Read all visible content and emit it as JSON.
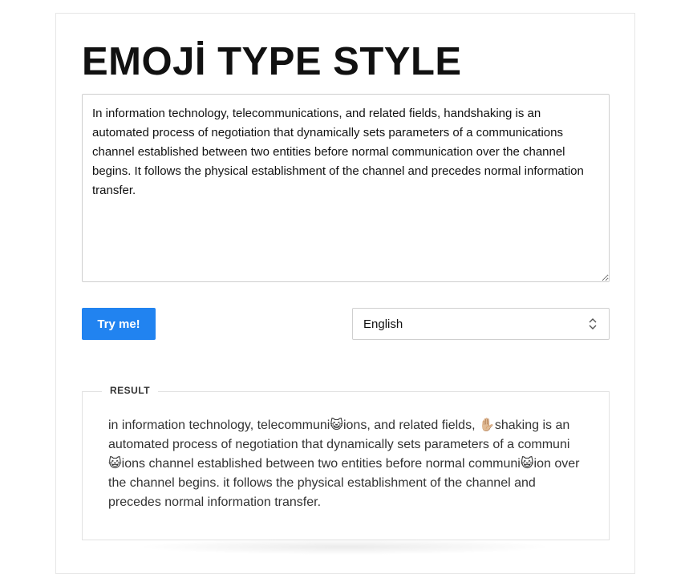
{
  "header": {
    "title": "EMOJİ TYPE STYLE"
  },
  "input": {
    "value": "In information technology, telecommunications, and related fields, handshaking is an automated process of negotiation that dynamically sets parameters of a communications channel established between two entities before normal communication over the channel begins. It follows the physical establishment of the channel and precedes normal information transfer."
  },
  "controls": {
    "try_label": "Try me!",
    "language": {
      "selected": "English"
    }
  },
  "result": {
    "label": "RESULT",
    "text": "in information technology, telecommuni😺ions, and related fields, ✋🏼shaking is an automated process of negotiation that dynamically sets parameters of a communi 😺ions channel established between two entities before normal communi😺ion over the channel begins. it follows the physical establishment of the channel and precedes normal information transfer."
  },
  "colors": {
    "accent": "#2183f0",
    "border": "#cfcfcf",
    "text": "#111111"
  },
  "icons": {
    "select_arrows": "up-down-chevron-icon"
  }
}
